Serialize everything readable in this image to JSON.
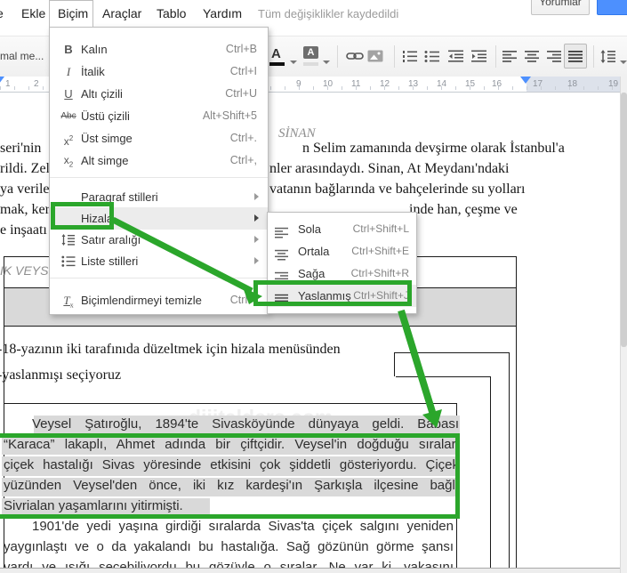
{
  "colors": {
    "annotation_green": "#2ba62b",
    "selection_gray": "#d9d9d9",
    "marker_blue": "#4d90fe",
    "button_blue": "#4d90fe"
  },
  "menubar": {
    "left_fragment": "e",
    "items": [
      {
        "label": "Ekle"
      },
      {
        "label": "Biçim"
      },
      {
        "label": "Araçlar"
      },
      {
        "label": "Tablo"
      },
      {
        "label": "Yardım"
      }
    ],
    "status": "Tüm değişiklikler kaydedildi",
    "comments_button": "Yorumlar"
  },
  "toolbar": {
    "styles_fragment": "mal me...",
    "text_color_glyph": "A",
    "highlight_glyph": "A"
  },
  "ruler": {
    "left_numbers": [
      "1",
      "2"
    ],
    "numbers": [
      "9",
      "10",
      "11",
      "12",
      "13",
      "14",
      "15",
      "16",
      "17",
      "18",
      "19"
    ]
  },
  "format_menu": {
    "items": [
      {
        "icon": "bold",
        "glyph": "B",
        "label": "Kalın",
        "shortcut": "Ctrl+B"
      },
      {
        "icon": "italic",
        "glyph": "I",
        "label": "İtalik",
        "shortcut": "Ctrl+I"
      },
      {
        "icon": "underline",
        "glyph": "U",
        "label": "Altı çizili",
        "shortcut": "Ctrl+U"
      },
      {
        "icon": "strikethrough",
        "glyph": "Abc",
        "label": "Üstü çizili",
        "shortcut": "Alt+Shift+5"
      },
      {
        "icon": "superscript",
        "glyph": "x",
        "sup": "2",
        "label": "Üst simge",
        "shortcut": "Ctrl+."
      },
      {
        "icon": "subscript",
        "glyph": "x",
        "sub": "2",
        "label": "Alt simge",
        "shortcut": "Ctrl+,"
      }
    ],
    "submenu_rows": [
      {
        "label": "Paragraf stilleri"
      },
      {
        "label": "Hizala"
      },
      {
        "label": "Satır aralığı"
      },
      {
        "label": "Liste stilleri"
      }
    ],
    "clear_item": {
      "glyph": "T",
      "sub": "x",
      "label": "Biçimlendirmeyi temizle",
      "shortcut": "Ctrl+\\"
    }
  },
  "align_submenu": {
    "items": [
      {
        "icon": "align-left",
        "label": "Sola",
        "shortcut": "Ctrl+Shift+L"
      },
      {
        "icon": "align-center",
        "label": "Ortala",
        "shortcut": "Ctrl+Shift+E"
      },
      {
        "icon": "align-right",
        "label": "Sağa",
        "shortcut": "Ctrl+Shift+R"
      },
      {
        "icon": "align-justify",
        "label": "Yaslanmış",
        "shortcut": "Ctrl+Shift+J"
      }
    ]
  },
  "document": {
    "sinan_title": "SİNAN",
    "sinan_lines": [
      {
        "left": "seri'nin",
        "right": "n Selim zamanında devşirme olarak İstanbul'a"
      },
      {
        "left": "rildi. Zel",
        "right": "nler arasındaydı. Sinan, At Meydanı'ndaki"
      },
      {
        "left": "ya verile",
        "right": "vatanın bağlarında ve bahçelerinde su yolları"
      },
      {
        "left": "mak, ker",
        "right": "inde han, çeşme ve"
      },
      {
        "left": "e inşaatı",
        "right": ""
      }
    ],
    "veysel_heading": "IK VEYSE",
    "instruction_line1": "-18-yazının iki tarafınıda düzeltmek için hizala menüsünden",
    "instruction_line2": "-yaslanmışı seçiyoruz",
    "watermark": "dijitalders.com",
    "selected_lines": [
      "Veysel Şatıroğlu, 1894'te Sivasköyünde dünyaya geldi. Babası",
      "“Karaca” lakaplı, Ahmet adında bir çiftçidir. Veysel'in doğduğu sıralar,",
      "çiçek hastalığı Sivas yöresinde etkisini çok şiddetli gösteriyordu. Çiçek",
      "yüzünden Veysel'den önce, iki kız kardeşi'ın Şarkışla ilçesine bağlı",
      "Sivrialan yaşamlarını yitirmişti."
    ],
    "paragraph2_lines": [
      "1901'de yedi yaşına girdiği sıralarda Sivas'ta çiçek salgını yeniden",
      "yaygınlaştı ve o da yakalandı bu hastalığa. Sağ gözünün görme şansı",
      "vardı ve ışığı seçebiliyordu bu gözüyle o sıralar. Ne var ki, yakasını"
    ]
  }
}
